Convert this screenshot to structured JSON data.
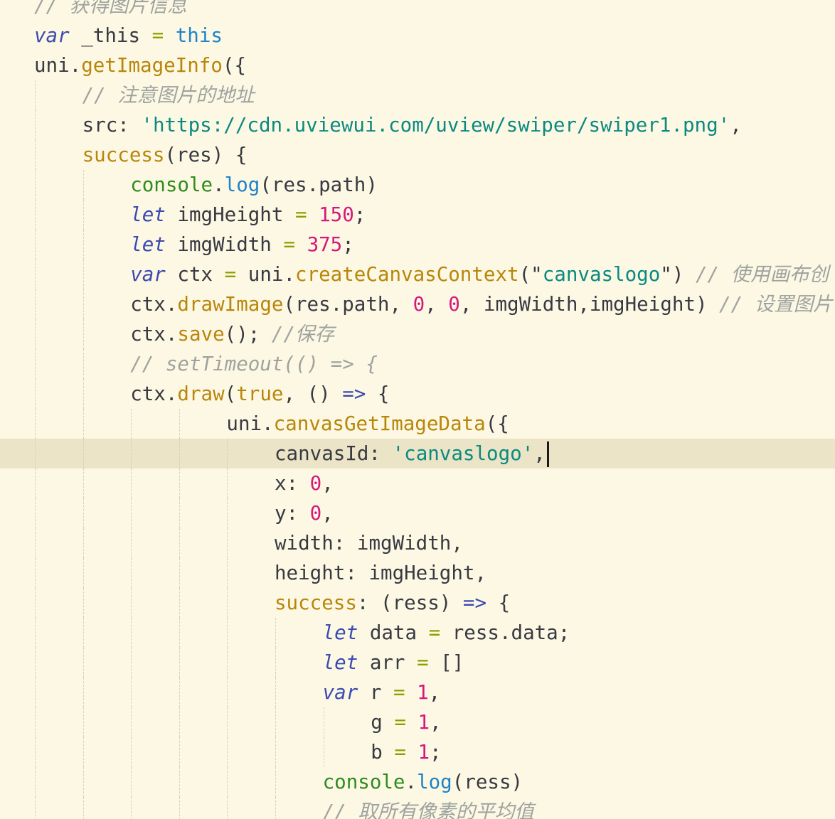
{
  "editor": {
    "lines": [
      {
        "indent": 2,
        "tokens": [
          [
            "comment",
            "// 获得图片信息"
          ]
        ]
      },
      {
        "indent": 2,
        "tokens": [
          [
            "keyword",
            "var"
          ],
          [
            "text",
            " _this "
          ],
          [
            "op",
            "="
          ],
          [
            "text",
            " "
          ],
          [
            "this",
            "this"
          ]
        ]
      },
      {
        "indent": 2,
        "tokens": [
          [
            "text",
            "uni."
          ],
          [
            "func",
            "getImageInfo"
          ],
          [
            "text",
            "({"
          ]
        ]
      },
      {
        "indent": 4,
        "tokens": [
          [
            "comment",
            "// 注意图片的地址"
          ]
        ]
      },
      {
        "indent": 4,
        "tokens": [
          [
            "text",
            "src: "
          ],
          [
            "string",
            "'https://cdn.uviewui.com/uview/swiper/swiper1.png'"
          ],
          [
            "text",
            ","
          ]
        ]
      },
      {
        "indent": 4,
        "tokens": [
          [
            "func",
            "success"
          ],
          [
            "text",
            "(res) {"
          ]
        ]
      },
      {
        "indent": 6,
        "tokens": [
          [
            "builtin",
            "console"
          ],
          [
            "text",
            "."
          ],
          [
            "this",
            "log"
          ],
          [
            "text",
            "(res.path)"
          ]
        ]
      },
      {
        "indent": 6,
        "tokens": [
          [
            "keyword",
            "let"
          ],
          [
            "text",
            " imgHeight "
          ],
          [
            "op",
            "="
          ],
          [
            "text",
            " "
          ],
          [
            "number",
            "150"
          ],
          [
            "text",
            ";"
          ]
        ]
      },
      {
        "indent": 6,
        "tokens": [
          [
            "keyword",
            "let"
          ],
          [
            "text",
            " imgWidth "
          ],
          [
            "op",
            "="
          ],
          [
            "text",
            " "
          ],
          [
            "number",
            "375"
          ],
          [
            "text",
            ";"
          ]
        ]
      },
      {
        "indent": 6,
        "tokens": [
          [
            "keyword",
            "var"
          ],
          [
            "text",
            " ctx "
          ],
          [
            "op",
            "="
          ],
          [
            "text",
            " uni."
          ],
          [
            "func",
            "createCanvasContext"
          ],
          [
            "text",
            "(\""
          ],
          [
            "string",
            "canvaslogo"
          ],
          [
            "text",
            "\") "
          ],
          [
            "comment",
            "// 使用画布创"
          ]
        ]
      },
      {
        "indent": 6,
        "tokens": [
          [
            "text",
            "ctx."
          ],
          [
            "func",
            "drawImage"
          ],
          [
            "text",
            "(res.path, "
          ],
          [
            "number",
            "0"
          ],
          [
            "text",
            ", "
          ],
          [
            "number",
            "0"
          ],
          [
            "text",
            ", imgWidth,imgHeight) "
          ],
          [
            "comment",
            "// 设置图片"
          ]
        ]
      },
      {
        "indent": 6,
        "tokens": [
          [
            "text",
            "ctx."
          ],
          [
            "func",
            "save"
          ],
          [
            "text",
            "(); "
          ],
          [
            "comment",
            "//保存"
          ]
        ]
      },
      {
        "indent": 6,
        "tokens": [
          [
            "comment",
            "// setTimeout(() => {"
          ]
        ]
      },
      {
        "indent": 6,
        "tokens": [
          [
            "text",
            "ctx."
          ],
          [
            "func",
            "draw"
          ],
          [
            "text",
            "("
          ],
          [
            "bool",
            "true"
          ],
          [
            "text",
            ", () "
          ],
          [
            "arrow",
            "=>"
          ],
          [
            "text",
            " {"
          ]
        ]
      },
      {
        "indent": 10,
        "tokens": [
          [
            "text",
            "uni."
          ],
          [
            "func",
            "canvasGetImageData"
          ],
          [
            "text",
            "({"
          ]
        ]
      },
      {
        "indent": 12,
        "current": true,
        "caret": true,
        "tokens": [
          [
            "text",
            "canvasId: "
          ],
          [
            "string",
            "'canvaslogo'"
          ],
          [
            "text",
            ","
          ]
        ]
      },
      {
        "indent": 12,
        "tokens": [
          [
            "text",
            "x: "
          ],
          [
            "number",
            "0"
          ],
          [
            "text",
            ","
          ]
        ]
      },
      {
        "indent": 12,
        "tokens": [
          [
            "text",
            "y: "
          ],
          [
            "number",
            "0"
          ],
          [
            "text",
            ","
          ]
        ]
      },
      {
        "indent": 12,
        "tokens": [
          [
            "text",
            "width: imgWidth,"
          ]
        ]
      },
      {
        "indent": 12,
        "tokens": [
          [
            "text",
            "height: imgHeight,"
          ]
        ]
      },
      {
        "indent": 12,
        "tokens": [
          [
            "func",
            "success"
          ],
          [
            "text",
            ": (ress) "
          ],
          [
            "arrow",
            "=>"
          ],
          [
            "text",
            " {"
          ]
        ]
      },
      {
        "indent": 14,
        "tokens": [
          [
            "keyword",
            "let"
          ],
          [
            "text",
            " data "
          ],
          [
            "op",
            "="
          ],
          [
            "text",
            " ress.data;"
          ]
        ]
      },
      {
        "indent": 14,
        "tokens": [
          [
            "keyword",
            "let"
          ],
          [
            "text",
            " arr "
          ],
          [
            "op",
            "="
          ],
          [
            "text",
            " []"
          ]
        ]
      },
      {
        "indent": 14,
        "tokens": [
          [
            "keyword",
            "var"
          ],
          [
            "text",
            " r "
          ],
          [
            "op",
            "="
          ],
          [
            "text",
            " "
          ],
          [
            "number",
            "1"
          ],
          [
            "text",
            ","
          ]
        ]
      },
      {
        "indent": 16,
        "tokens": [
          [
            "text",
            "g "
          ],
          [
            "op",
            "="
          ],
          [
            "text",
            " "
          ],
          [
            "number",
            "1"
          ],
          [
            "text",
            ","
          ]
        ]
      },
      {
        "indent": 16,
        "tokens": [
          [
            "text",
            "b "
          ],
          [
            "op",
            "="
          ],
          [
            "text",
            " "
          ],
          [
            "number",
            "1"
          ],
          [
            "text",
            ";"
          ]
        ]
      },
      {
        "indent": 14,
        "tokens": [
          [
            "builtin",
            "console"
          ],
          [
            "text",
            "."
          ],
          [
            "this",
            "log"
          ],
          [
            "text",
            "(ress)"
          ]
        ]
      },
      {
        "indent": 14,
        "tokens": [
          [
            "comment",
            "// 取所有像素的平均值"
          ]
        ]
      }
    ]
  },
  "colors": {
    "background": "#fdf8e4",
    "current_line": "#ebe4c6",
    "comment": "#9ea39f",
    "keyword": "#3b4ab0",
    "function": "#b8860b",
    "string": "#0a8a80",
    "number": "#d6177d",
    "operator": "#89a000"
  }
}
